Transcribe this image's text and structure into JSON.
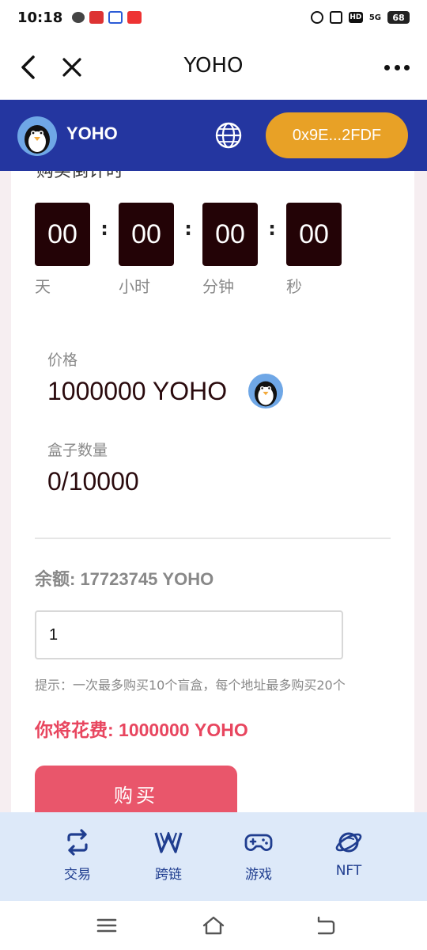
{
  "status_bar": {
    "time": "10:18",
    "network": "5G",
    "battery": "68",
    "hd": "HD"
  },
  "title_bar": {
    "title": "YOHO"
  },
  "header": {
    "brand": "YOHO",
    "wallet_address": "0x9E...2FDF"
  },
  "countdown": {
    "title": "购买倒计时",
    "units": [
      {
        "value": "00",
        "label": "天"
      },
      {
        "value": "00",
        "label": "小时"
      },
      {
        "value": "00",
        "label": "分钟"
      },
      {
        "value": "00",
        "label": "秒"
      }
    ],
    "separator": ":"
  },
  "price": {
    "label": "价格",
    "value": "1000000 YOHO"
  },
  "box_count": {
    "label": "盒子数量",
    "value": "0/10000"
  },
  "balance": "余额: 17723745 YOHO",
  "quantity_input": {
    "value": "1"
  },
  "hint": "提示：一次最多购买10个盲盒，每个地址最多购买20个",
  "cost": "你将花费: 1000000 YOHO",
  "buy_button": "购买",
  "bottom_nav": [
    {
      "label": "交易",
      "icon": "swap-icon"
    },
    {
      "label": "跨链",
      "icon": "bridge-icon"
    },
    {
      "label": "游戏",
      "icon": "gamepad-icon"
    },
    {
      "label": "NFT",
      "icon": "planet-icon"
    }
  ],
  "colors": {
    "header_bg": "#2436a0",
    "wallet_btn": "#e8a126",
    "countdown_box": "#230306",
    "cost_text": "#e8465f",
    "buy_btn": "#e9566b",
    "nav_bg": "#dde9f9",
    "nav_accent": "#1f3d8f"
  }
}
